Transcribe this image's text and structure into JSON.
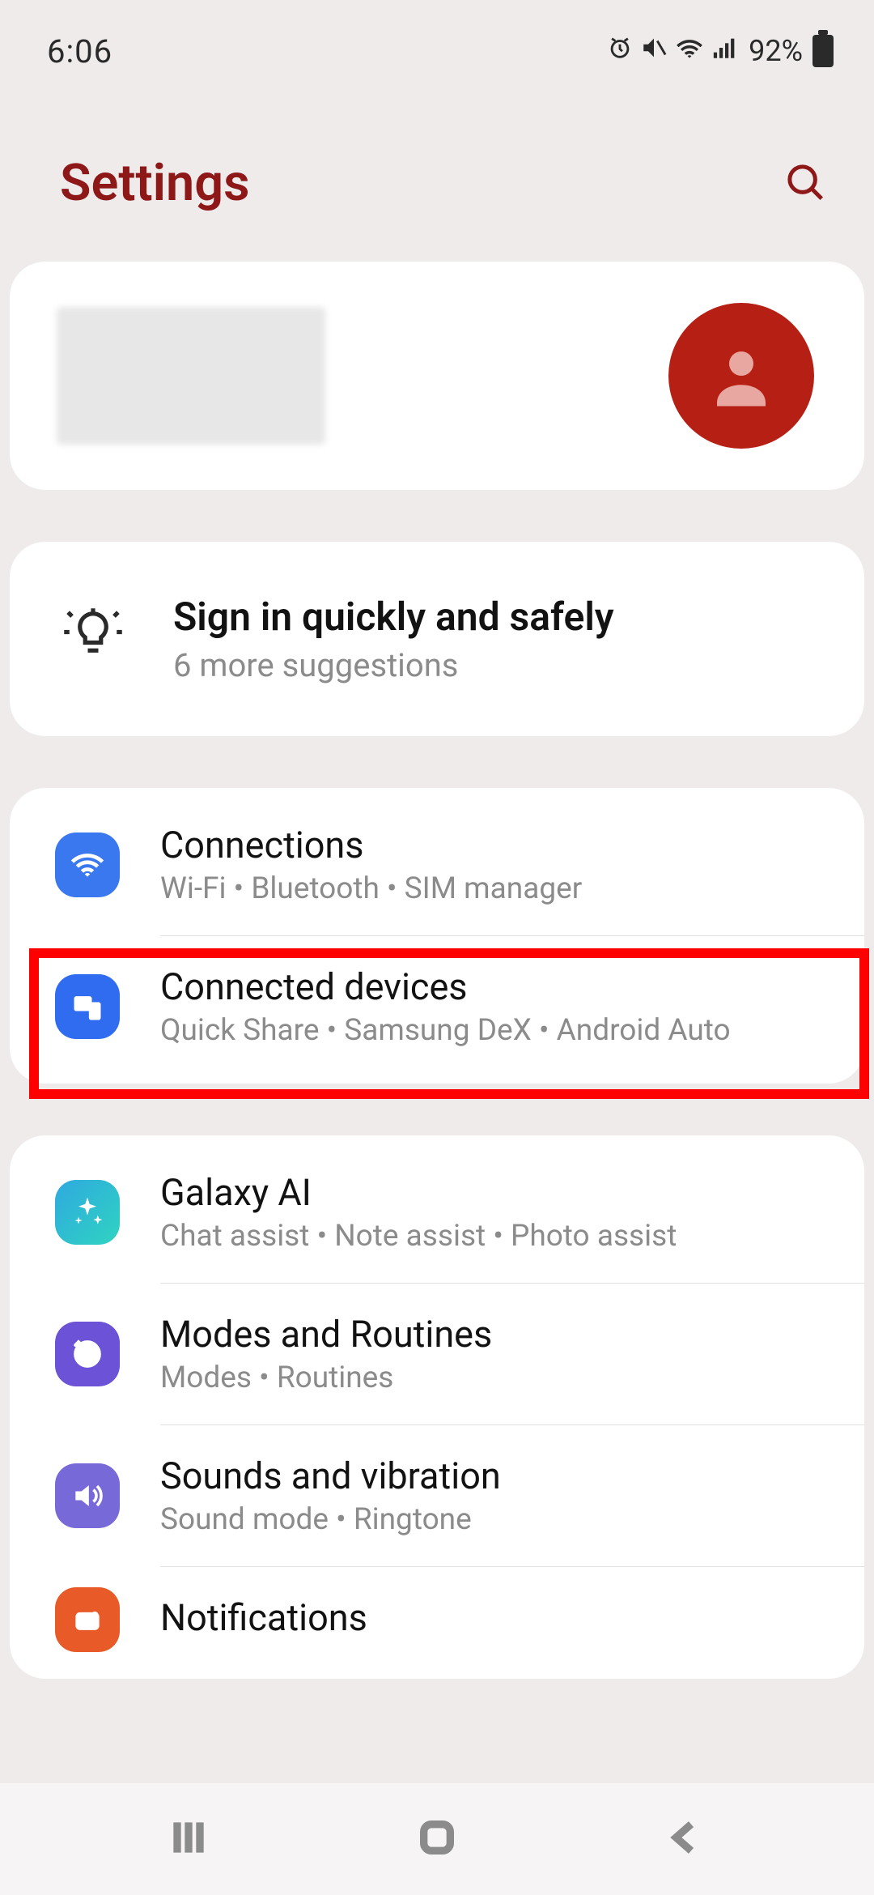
{
  "status": {
    "time": "6:06",
    "battery": "92%"
  },
  "page_title": "Settings",
  "suggestion": {
    "title": "Sign in quickly and safely",
    "subtitle": "6 more suggestions"
  },
  "groups": [
    {
      "items": [
        {
          "title": "Connections",
          "subtitle": "Wi-Fi  •  Bluetooth  •  SIM manager",
          "icon": "wifi",
          "bg": "bg-blue"
        },
        {
          "title": "Connected devices",
          "subtitle": "Quick Share  •  Samsung DeX  •  Android Auto",
          "icon": "devices",
          "bg": "bg-blue2"
        }
      ],
      "highlighted_index": 1
    },
    {
      "items": [
        {
          "title": "Galaxy AI",
          "subtitle": "Chat assist  •  Note assist  •  Photo assist",
          "icon": "sparkle",
          "bg": "bg-ai"
        },
        {
          "title": "Modes and Routines",
          "subtitle": "Modes  •  Routines",
          "icon": "check-cycle",
          "bg": "bg-purple"
        },
        {
          "title": "Sounds and vibration",
          "subtitle": "Sound mode  •  Ringtone",
          "icon": "speaker",
          "bg": "bg-purple2"
        },
        {
          "title": "Notifications",
          "subtitle": "",
          "icon": "bell",
          "bg": "bg-orange"
        }
      ]
    }
  ]
}
